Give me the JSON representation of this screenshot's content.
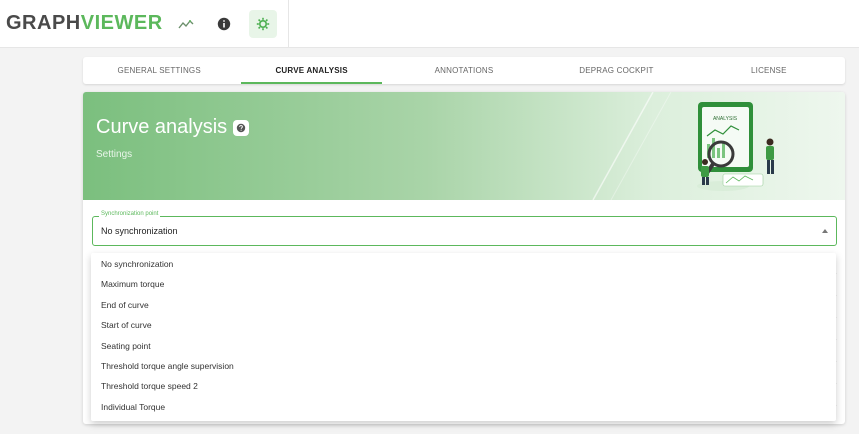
{
  "header": {
    "logo_part1": "GRAPH",
    "logo_part2": "VIEWER",
    "icons": [
      "chart-wave-icon",
      "info-icon",
      "settings-gear-icon"
    ]
  },
  "tabs": [
    {
      "label": "GENERAL SETTINGS",
      "active": false
    },
    {
      "label": "CURVE ANALYSIS",
      "active": true
    },
    {
      "label": "ANNOTATIONS",
      "active": false
    },
    {
      "label": "DEPRAG COCKPIT",
      "active": false
    },
    {
      "label": "LICENSE",
      "active": false
    }
  ],
  "hero": {
    "title": "Curve analysis",
    "subtitle": "Settings",
    "illustration_text": "ANALYSIS"
  },
  "sync": {
    "label": "Synchronization point",
    "value": "No synchronization",
    "options": [
      "No synchronization",
      "Maximum torque",
      "End of curve",
      "Start of curve",
      "Seating point",
      "Threshold torque angle supervision",
      "Threshold torque speed 2",
      "Individual Torque"
    ]
  },
  "colors": {
    "accent": "#5cb85c",
    "hero_start": "#7bbf7e",
    "text_dark": "#222222"
  }
}
